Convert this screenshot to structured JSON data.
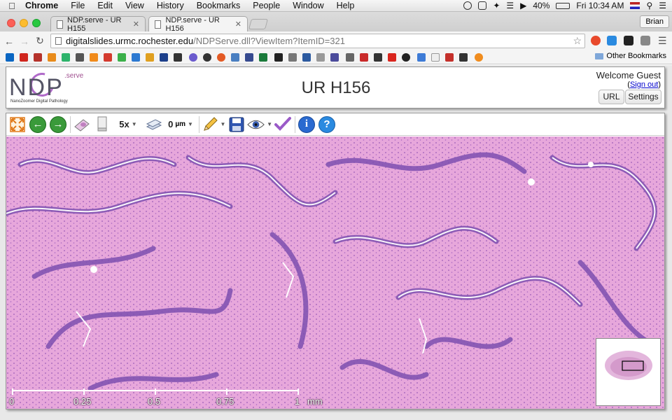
{
  "menubar": {
    "app": "Chrome",
    "items": [
      "File",
      "Edit",
      "View",
      "History",
      "Bookmarks",
      "People",
      "Window",
      "Help"
    ],
    "battery": "40%",
    "clock": "Fri 10:34 AM"
  },
  "browser": {
    "tabs": [
      {
        "title": "NDP.serve - UR H155"
      },
      {
        "title": "NDP.serve - UR H156"
      }
    ],
    "profile": "Brian",
    "url_host": "digitalslides.urmc.rochester.edu",
    "url_path": "/NDPServe.dll?ViewItem?ItemID=321",
    "other_bookmarks": "Other Bookmarks",
    "bookmark_icons": [
      "in",
      "Z",
      "g",
      "M",
      "Y",
      "VB",
      "U",
      "H"
    ],
    "colors": {
      "accent": "#f5bd4f"
    }
  },
  "page": {
    "logo": {
      "main": "NDP",
      "super": ".serve",
      "tagline": "NanoZoomer Digital Pathology"
    },
    "title": "UR H156",
    "welcome": "Welcome Guest",
    "sign_out": "Sign out",
    "url_button": "URL",
    "settings_button": "Settings"
  },
  "viewer": {
    "magnification": "5x",
    "z_offset": "0",
    "z_unit": "µm",
    "scale": {
      "ticks": [
        "0",
        "0.25",
        "0.5",
        "0.75",
        "1"
      ],
      "unit": "mm"
    },
    "tissue_colors": {
      "stroma": "#e8a8dc",
      "epithelium": "#7e4fb0",
      "lumen": "#ffffff"
    }
  }
}
